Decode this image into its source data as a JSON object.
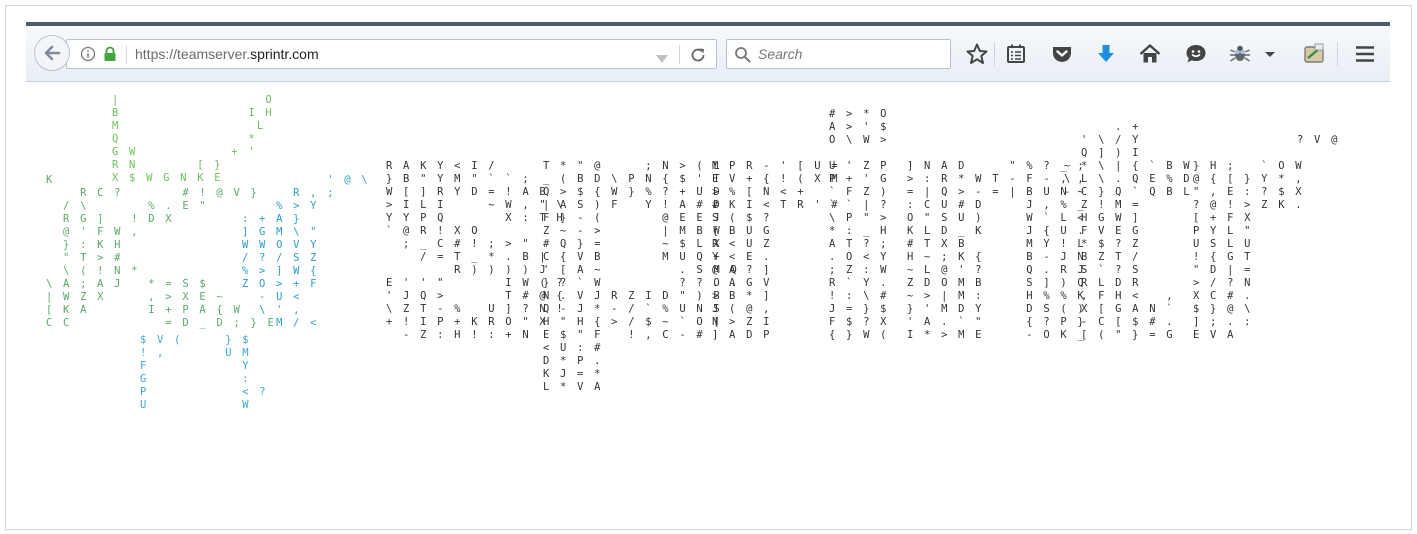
{
  "browser": {
    "url_prefix": "https://teamserver.",
    "url_domain": "sprintr.com",
    "search_placeholder": "Search",
    "icons": {
      "back": "back-arrow-icon",
      "info": "info-icon",
      "lock": "lock-icon",
      "dropdown": "dropdown-arrow-icon",
      "reload": "reload-icon",
      "search": "search-icon",
      "bookmark": "star-icon",
      "reader": "reading-list-icon",
      "pocket": "pocket-icon",
      "downloads": "download-arrow-icon",
      "home": "home-icon",
      "hello": "chat-bubble-icon",
      "bug": "bug-icon",
      "screenshot": "screenshot-icon",
      "menu": "hamburger-menu-icon"
    },
    "colors": {
      "accent_blue": "#1f8fe0",
      "lock_green": "#3ea63e"
    }
  },
  "matrix": {
    "star_blocks": [
      "|                 O\nB               I H\nM                L\nQ               *\nG W           + '\nR N       [ }\nX $ W G N K E",
      "K\n    R C ?       # ! @ V }\n  / \\       % . E \"\n  R G ]   ! D X\n  @ ' F W ,\n  } : K H\n  \" T > #\n  \\ ( ! N *\n\\ A ; A J   * = S $\n| W Z X     , > X E ~\n[ K A       I + P A { W\nC C           = D _ D ; } E",
      "          ' @ \\\n      R , ;\n    % > Y\n: + A }\n] G M \\ \"\nW W O V Y\n/ ? / S Z\n% > ] W {\nZ O > + F\n  - U <\n  \\ ' ,\n    M / <",
      "$ V (     } $\n! ,       U M\nF           Y\nG           :\nP           < ?\nU           W"
    ],
    "columns": [
      "R A K Y < I /\n} B \" Y M \" ` ` ;\nW [ ] R Y D = ! A B\n> I L I     ~ W , \" \\\nY Y P Q       X : T H\n` @ R ! X O\n  ; _ C # ! ; > \"\n    / = T _ * . B |\n        R ) ) ) ) J\nE ' ' \"       I W ( ?\n' J Q >       T # @ {\n\\ Z T - %   U ] ? N !\n+ ! I P + K R O \" X\n  - Z : H ! : + N",
      "T * \" @     ; N > ( L\n_ ( B D \\ P N { $ ' T\nQ > $ { W } % ? + U D\n| A S ) F   Y ! A # D\nF } - (       @ E E J\nZ ~ - >       | M B W\n# Q } =       ~ $ L X\nC { V B       M U Q +\n' [ A ~         . S M Q\n} ? ` W         ? ? O .\nN . V J R Z I D \" ) B\nQ - J * - / ` % U N S\nH \" H { > / $ ~ ` O [\nE $ \" F   ! , C - #\n< U : #\nD * P .\nK J = *\nL * V A",
      "M P R - ' [ U =\nE V + { ! ( X M\n> % [ N < +\n# K I < T R ' #\nS ( $ ?\n{ B U G\nR < U Z\nY < E .\n@ A ? ]\n. A G V\n> B * ]\nJ ( @ ,\nN > Z I\n] A D P",
      "# > * O\nA > ' $\nO \\ W >\n\nU ' Z P\nP + ' G\n` F Z )\n` ` | ?\n\\ P \" >\n* : _ H\nA T ? ;\n. O < Y\n; Z : W\nR ` Y .\n! : \\ #\nJ = } $\nF $ ? X\n{ } W (",
      "] N A D     \" % ? _ ;\n> : R * W T - F - , ,\n= | Q > - = | B U N ~\n: C U # D     J , % _\nO \" S U )     W ` L <\nK L D _ K     J { U .\n# T X B       M Y ! L\nH ~ ; K {     B - J N\n~ L @ ' ?     Q . R J\nZ D O M B     S ] ) Q\n~ > | M :     H % % K\n} ' M D Y     D S ( )\n' A . ` \"     { ? P }\nI * > M E     - O K _",
      "      . +\n  ' \\ / Y\n  Q ] ) I\n~ * \\ | { ` B W\n\\ L \\ . Q E % D\n- C } Q ` Q B L\n  Z ! M =\n  H G W ]\n  F V E G\n  * $ ? Z\n  B Z T /\n  S ` ? S\n  R L D R\n  , F H <   ,\n  X [ G A N `\n  - C [ $ # .\n  [ ( \" } = G",
      "} H ;   ` O W\n@ { [ } Y * ,\n\" , E : ? $ X\n? @ ! > Z K .\n[ + F X\nP Y L \"\nU S L U\n! { G T\n\" D | =\n> / ? N\nX C # .\n$ } @ \\\n] ; . :\nE V A",
      "? V @"
    ]
  }
}
